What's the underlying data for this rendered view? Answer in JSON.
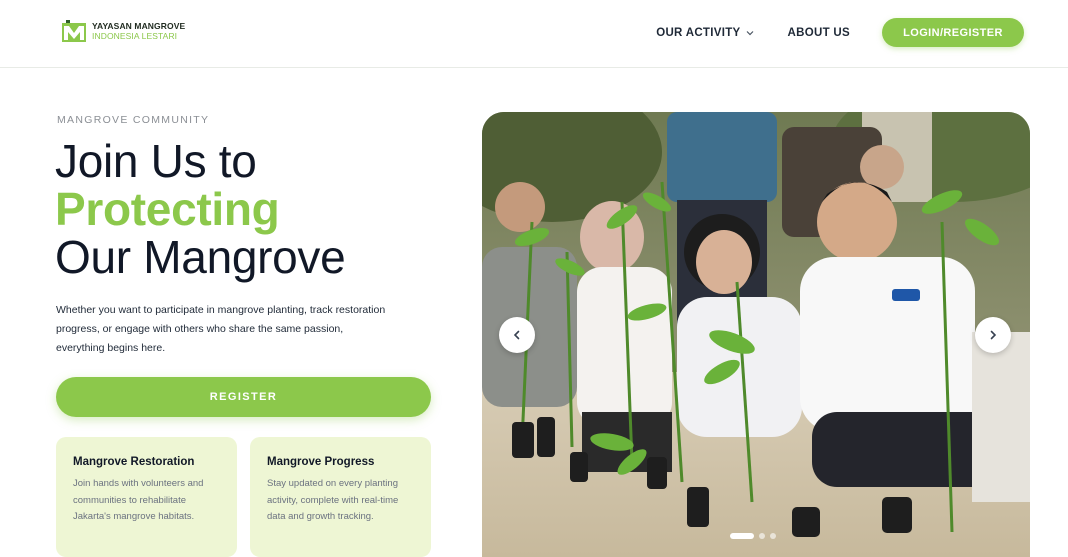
{
  "header": {
    "logo_line1": "YAYASAN MANGROVE",
    "logo_line2": "INDONESIA LESTARI",
    "nav_activity": "OUR ACTIVITY",
    "nav_about": "ABOUT US",
    "login_label": "LOGIN/REGISTER"
  },
  "hero": {
    "eyebrow": "MANGROVE COMMUNITY",
    "headline_line1": "Join Us to",
    "headline_accent": "Protecting",
    "headline_line3": "Our Mangrove",
    "description": "Whether you want to participate in mangrove planting, track restoration progress, or engage with others who share the same passion, everything begins here.",
    "register_label": "REGISTER"
  },
  "cards": [
    {
      "title": "Mangrove Restoration",
      "body": "Join hands with volunteers and communities to rehabilitate Jakarta's mangrove habitats."
    },
    {
      "title": "Mangrove Progress",
      "body": "Stay updated on every planting activity, complete with real-time data and growth tracking."
    }
  ],
  "carousel": {
    "slide_count": 3,
    "active_index": 0,
    "image_subject": "volunteers planting mangrove seedlings"
  },
  "colors": {
    "accent": "#8cc84b",
    "card_bg": "#eef6d4",
    "text_dark": "#111827"
  },
  "icons": {
    "logo": "mangrove-logo-icon",
    "nav_dropdown": "chevron-down-icon",
    "prev": "chevron-left-icon",
    "next": "chevron-right-icon"
  }
}
